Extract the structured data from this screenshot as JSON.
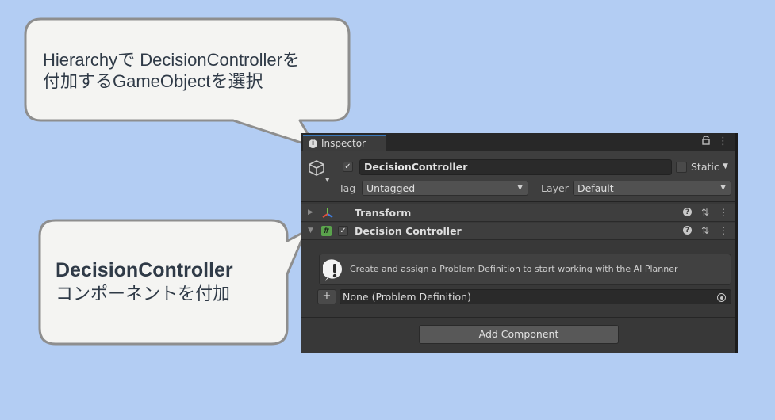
{
  "callouts": {
    "top": {
      "line1": "Hierarchyで DecisionControllerを",
      "line2": "付加するGameObjectを選択"
    },
    "bottom": {
      "title": "DecisionController",
      "subtitle": "コンポーネントを付加"
    }
  },
  "inspector": {
    "tab_label": "Inspector",
    "tab_icon": "info-icon",
    "tab_tools": [
      "lock-icon",
      "kebab-menu-icon"
    ],
    "gameobject": {
      "icon": "cube-icon",
      "active": true,
      "name": "DecisionController",
      "static_label": "Static",
      "static_checked": false,
      "tag_label": "Tag",
      "tag_value": "Untagged",
      "layer_label": "Layer",
      "layer_value": "Default"
    },
    "components": [
      {
        "name": "Transform",
        "icon": "transform-axes-icon",
        "expanded": false,
        "has_checkbox": false
      },
      {
        "name": "Decision Controller",
        "icon": "script-hash-icon",
        "expanded": true,
        "has_checkbox": true,
        "enabled": true
      }
    ],
    "help_message": "Create and assign a Problem Definition to start working with the AI Planner",
    "object_field": {
      "plus": "+",
      "value": "None (Problem Definition)"
    },
    "add_component_label": "Add Component"
  },
  "colors": {
    "background": "#b3cdf3",
    "callout_fill": "#f4f4f2",
    "callout_stroke": "#8e8e8e",
    "inspector_bg": "#383838",
    "tab_accent": "#3a79bb",
    "script_icon": "#5aa34c"
  }
}
